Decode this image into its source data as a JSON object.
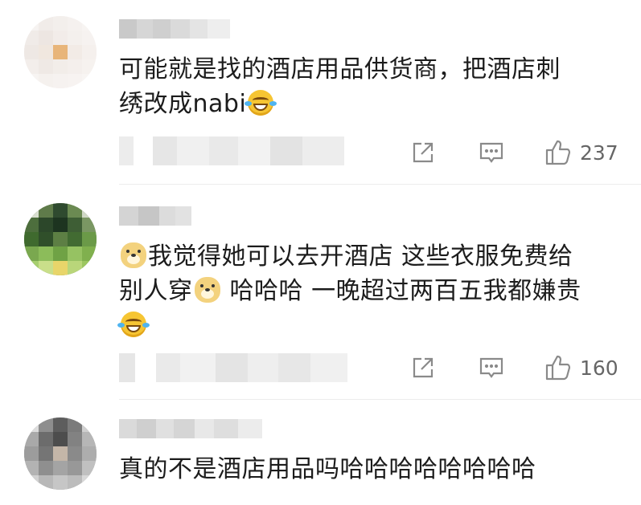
{
  "comments": [
    {
      "username": "",
      "text_line1": "可能就是找的酒店用品供货商，把酒店刺",
      "text_line2": "绣改成nabi",
      "emoji_end": "laugh-cry-emoji",
      "likes": "237"
    },
    {
      "username": "",
      "text_line1": "我觉得她可以去开酒店 这些衣服免费给",
      "text_line2a": "别人穿",
      "text_line2b": " 哈哈哈 一晚超过两百五我都嫌贵",
      "emojis": [
        "doge-emoji",
        "doge-emoji",
        "laugh-cry-emoji"
      ],
      "likes": "160"
    },
    {
      "username": "",
      "text_line1": "真的不是酒店用品吗哈哈哈哈哈哈哈哈"
    }
  ],
  "icons": {
    "share": "share-icon",
    "comment": "comment-icon",
    "like": "thumbs-up-icon"
  },
  "colors": {
    "icon_gray": "#8a8a8a",
    "text": "#1c1c1c",
    "count": "#666666"
  }
}
